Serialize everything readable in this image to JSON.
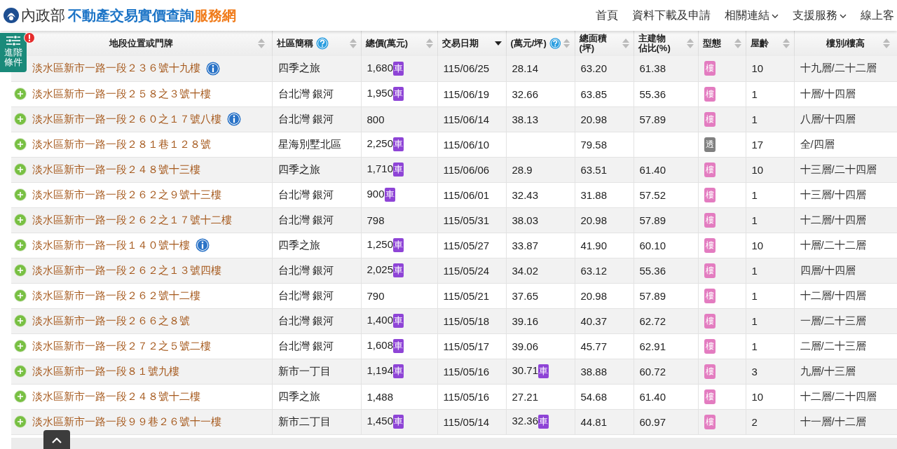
{
  "site": {
    "ministry": "內政部",
    "title": "不動產交易實價查詢",
    "title_suffix": "服務網"
  },
  "nav": [
    {
      "label": "首頁",
      "dropdown": false
    },
    {
      "label": "資料下載及申請",
      "dropdown": false
    },
    {
      "label": "相關連結",
      "dropdown": true
    },
    {
      "label": "支援服務",
      "dropdown": true
    },
    {
      "label": "線上客",
      "dropdown": false
    }
  ],
  "filter_button": {
    "label": "進階條件",
    "alert": true
  },
  "table": {
    "columns": [
      {
        "label": "地段位置或門牌",
        "help": false,
        "sorted": false
      },
      {
        "label": "社區簡稱",
        "help": true,
        "sorted": false
      },
      {
        "label": "總價(萬元)",
        "help": false,
        "sorted": false
      },
      {
        "label": "交易日期",
        "help": false,
        "sorted": true
      },
      {
        "label": "(萬元/坪)",
        "help": true,
        "sorted": false
      },
      {
        "label": "總面積",
        "sublabel": "(坪)",
        "help": false,
        "sorted": false
      },
      {
        "label": "主建物",
        "sublabel": "佔比(%)",
        "help": false,
        "sorted": false
      },
      {
        "label": "型態",
        "help": false,
        "sorted": false
      },
      {
        "label": "屋齡",
        "help": false,
        "sorted": false
      },
      {
        "label": "樓別/樓高",
        "help": false,
        "sorted": false
      }
    ],
    "rows": [
      {
        "address": "淡水區新市一路一段２３６號十九樓",
        "info": true,
        "community": "四季之旅",
        "price": "1,680",
        "parking": "車",
        "date": "115/06/25",
        "unit_price": "28.14",
        "area": "63.20",
        "ratio": "61.38",
        "type": "樓",
        "color": "#e37cc0",
        "age": "10",
        "floor": "十九層/二十二層"
      },
      {
        "address": "淡水區新市一路一段２５８之３號十樓",
        "info": false,
        "community": "台北灣 銀河",
        "price": "1,950",
        "parking": "車",
        "date": "115/06/19",
        "unit_price": "32.66",
        "area": "63.85",
        "ratio": "55.36",
        "type": "樓",
        "color": "#e37cc0",
        "age": "1",
        "floor": "十層/十四層"
      },
      {
        "address": "淡水區新市一路一段２６０之１７號八樓",
        "info": true,
        "community": "台北灣 銀河",
        "price": "800",
        "date": "115/06/14",
        "unit_price": "38.13",
        "area": "20.98",
        "ratio": "57.89",
        "type": "樓",
        "color": "#e37cc0",
        "age": "1",
        "floor": "八層/十四層"
      },
      {
        "address": "淡水區新市一路一段２８１巷１２８號",
        "info": false,
        "community": "星海別墅北區",
        "price": "2,250",
        "parking": "車",
        "date": "115/06/10",
        "area": "79.58",
        "type": "透",
        "color": "#808080",
        "age": "17",
        "floor": "全/四層"
      },
      {
        "address": "淡水區新市一路一段２４８號十三樓",
        "info": false,
        "community": "四季之旅",
        "price": "1,710",
        "parking": "車",
        "date": "115/06/06",
        "unit_price": "28.9",
        "area": "63.51",
        "ratio": "61.40",
        "type": "樓",
        "color": "#e37cc0",
        "age": "10",
        "floor": "十三層/二十四層"
      },
      {
        "address": "淡水區新市一路一段２６２之９號十三樓",
        "info": false,
        "community": "台北灣 銀河",
        "price": "900",
        "parking": "車",
        "date": "115/06/01",
        "unit_price": "32.43",
        "area": "31.88",
        "ratio": "57.52",
        "type": "樓",
        "color": "#e37cc0",
        "age": "1",
        "floor": "十三層/十四層"
      },
      {
        "address": "淡水區新市一路一段２６２之１７號十二樓",
        "info": false,
        "community": "台北灣 銀河",
        "price": "798",
        "date": "115/05/31",
        "unit_price": "38.03",
        "area": "20.98",
        "ratio": "57.89",
        "type": "樓",
        "color": "#e37cc0",
        "age": "1",
        "floor": "十二層/十四層"
      },
      {
        "address": "淡水區新市一路一段１４０號十樓",
        "info": true,
        "community": "四季之旅",
        "price": "1,250",
        "parking": "車",
        "date": "115/05/27",
        "unit_price": "33.87",
        "area": "41.90",
        "ratio": "60.10",
        "type": "樓",
        "color": "#e37cc0",
        "age": "10",
        "floor": "十層/二十二層"
      },
      {
        "address": "淡水區新市一路一段２６２之１３號四樓",
        "info": false,
        "community": "台北灣 銀河",
        "price": "2,025",
        "parking": "車",
        "date": "115/05/24",
        "unit_price": "34.02",
        "area": "63.12",
        "ratio": "55.36",
        "type": "樓",
        "color": "#e37cc0",
        "age": "1",
        "floor": "四層/十四層"
      },
      {
        "address": "淡水區新市一路一段２６２號十二樓",
        "info": false,
        "community": "台北灣 銀河",
        "price": "790",
        "date": "115/05/21",
        "unit_price": "37.65",
        "area": "20.98",
        "ratio": "57.89",
        "type": "樓",
        "color": "#e37cc0",
        "age": "1",
        "floor": "十二層/十四層"
      },
      {
        "address": "淡水區新市一路一段２６６之８號",
        "info": false,
        "community": "台北灣 銀河",
        "price": "1,400",
        "parking": "車",
        "date": "115/05/18",
        "unit_price": "39.16",
        "area": "40.37",
        "ratio": "62.72",
        "type": "樓",
        "color": "#e37cc0",
        "age": "1",
        "floor": "一層/二十三層"
      },
      {
        "address": "淡水區新市一路一段２７２之５號二樓",
        "info": false,
        "community": "台北灣 銀河",
        "price": "1,608",
        "parking": "車",
        "date": "115/05/17",
        "unit_price": "39.06",
        "area": "45.77",
        "ratio": "62.91",
        "type": "樓",
        "color": "#e37cc0",
        "age": "1",
        "floor": "二層/二十三層"
      },
      {
        "address": "淡水區新市一路一段８１號九樓",
        "info": false,
        "community": "新市一丁目",
        "price": "1,194",
        "parking": "車",
        "date": "115/05/16",
        "unit_price": "30.71",
        "unit_parking": "車",
        "area": "38.88",
        "ratio": "60.72",
        "type": "樓",
        "color": "#e37cc0",
        "age": "3",
        "floor": "九層/十三層"
      },
      {
        "address": "淡水區新市一路一段２４８號十二樓",
        "info": false,
        "community": "四季之旅",
        "price": "1,488",
        "date": "115/05/16",
        "unit_price": "27.21",
        "area": "54.68",
        "ratio": "61.40",
        "type": "樓",
        "color": "#e37cc0",
        "age": "10",
        "floor": "十二層/二十四層"
      },
      {
        "address": "淡水區新市一路一段９９巷２６號十一樓",
        "info": false,
        "community": "新市二丁目",
        "price": "1,450",
        "parking": "車",
        "date": "115/05/14",
        "unit_price": "32.36",
        "unit_parking": "車",
        "area": "44.81",
        "ratio": "60.97",
        "type": "樓",
        "color": "#e37cc0",
        "age": "2",
        "floor": "十一層/十二層"
      }
    ]
  }
}
